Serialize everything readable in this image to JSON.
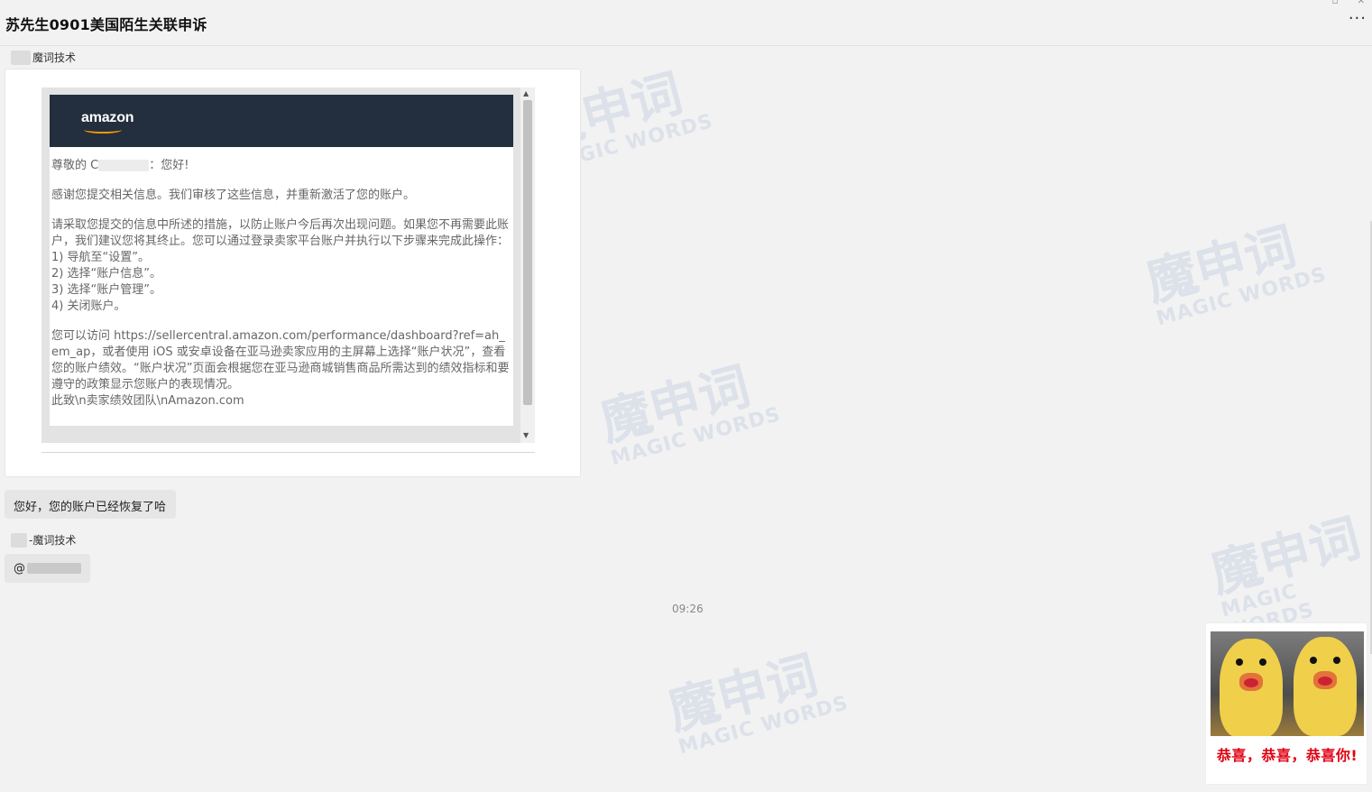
{
  "header": {
    "title": "苏先生0901美国陌生关联申诉",
    "more_icon": "more-horizontal-icon",
    "more_label": "···"
  },
  "watermark": {
    "big": "魔申词",
    "small": "MAGIC WORDS"
  },
  "messages": {
    "sender_1": "魔词技术",
    "email": {
      "logo_text": "amazon",
      "greeting_prefix": "尊敬的 C",
      "greeting_suffix": "：您好!",
      "para_1": "感谢您提交相关信息。我们审核了这些信息，并重新激活了您的账户。",
      "para_2": "请采取您提交的信息中所述的措施，以防止账户今后再次出现问题。如果您不再需要此账户，我们建议您将其终止。您可以通过登录卖家平台账户并执行以下步骤来完成此操作：",
      "steps": [
        " 1) 导航至“设置”。",
        "2) 选择“账户信息”。",
        "3) 选择“账户管理”。",
        "4) 关闭账户。"
      ],
      "para_3": "您可以访问 https://sellercentral.amazon.com/performance/dashboard?ref=ah_em_ap，或者使用 iOS 或安卓设备在亚马逊卖家应用的主屏幕上选择“账户状况”，查看您的账户绩效。“账户状况”页面会根据您在亚马逊商城销售商品所需达到的绩效指标和要遵守的政策显示您账户的表现情况。",
      "closing": "此致\\n卖家绩效团队\\nAmazon.com"
    },
    "bubble_1": "您好，您的账户已经恢复了哈",
    "sender_2": "-魔词技术",
    "bubble_2_prefix": "@",
    "time": "09:26",
    "sticker_text": "恭喜，恭喜，恭喜你!"
  }
}
